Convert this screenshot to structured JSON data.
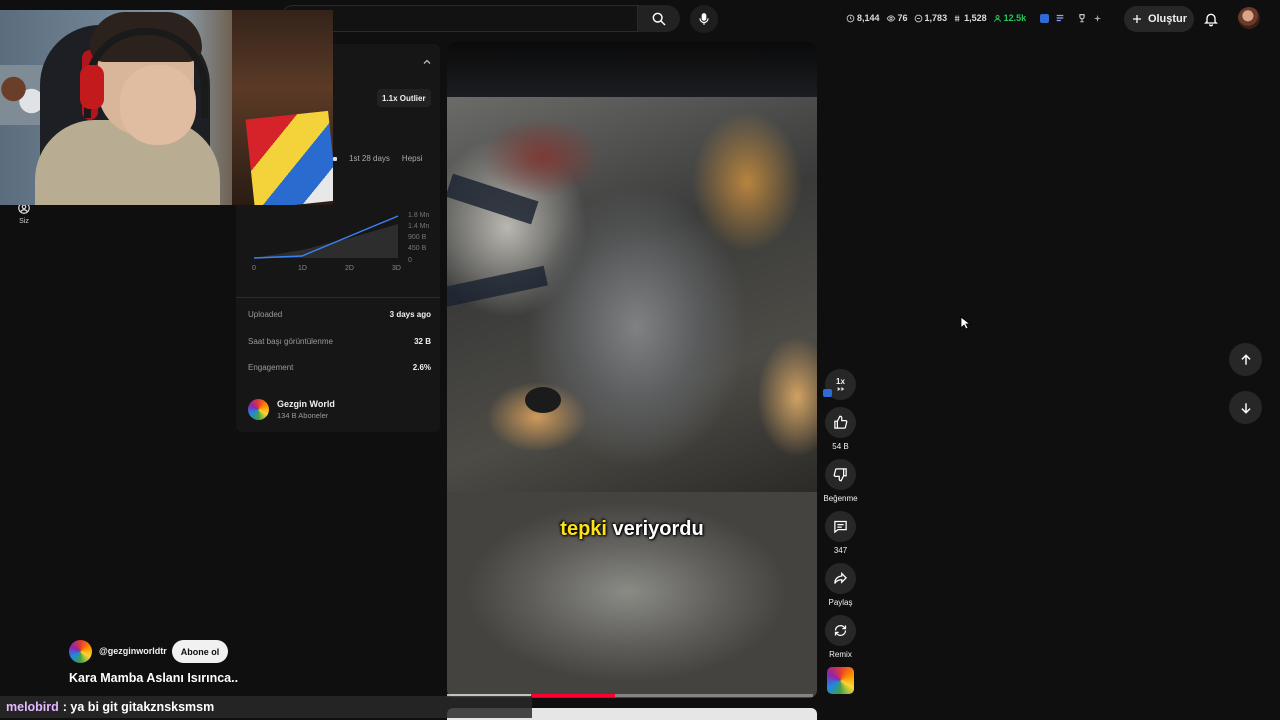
{
  "header": {
    "create_label": "Oluştur",
    "stats": [
      {
        "icon": "clock-icon",
        "value": "8,144"
      },
      {
        "icon": "eye-icon",
        "value": "76"
      },
      {
        "icon": "views-icon",
        "value": "1,783"
      },
      {
        "icon": "coin-icon",
        "value": "1,528"
      },
      {
        "icon": "user-icon",
        "value": "12.5k",
        "color": "#22c55e"
      }
    ]
  },
  "sidebar": {
    "you_label": "Siz"
  },
  "analytics": {
    "outlier_badge": "1.1x Outlier",
    "range_tabs": [
      "1st 28 days",
      "Hepsi"
    ],
    "chart": {
      "x_labels": [
        "0",
        "1D",
        "2D",
        "3D"
      ],
      "y_labels": [
        "1.8 Mn",
        "1.4 Mn",
        "900 B",
        "450 B",
        "0"
      ]
    },
    "metrics": [
      {
        "label": "Uploaded",
        "value": "3 days ago"
      },
      {
        "label": "Saat başı görüntülenme",
        "value": "32 B"
      },
      {
        "label": "Engagement",
        "value": "2.6%"
      }
    ],
    "channel": {
      "name": "Gezgin World",
      "subs": "134 B Aboneler"
    }
  },
  "video": {
    "caption_highlight": "tepki",
    "caption_rest": " veriyordu",
    "progress_played": 0.46,
    "progress_buffered": 0.23
  },
  "actions": {
    "speed": "1x",
    "like_count": "54 B",
    "dislike_label": "Beğenme",
    "comment_count": "347",
    "share_label": "Paylaş",
    "remix_label": "Remix"
  },
  "overlay": {
    "handle": "@gezginworldtr",
    "subscribe_label": "Abone ol",
    "title": "Kara Mamba Aslanı Isırınca.."
  },
  "chat": {
    "user": "melobird",
    "message": ": ya bi git gitakznsksmsm"
  },
  "colors": {
    "accent_red": "#ff0033",
    "caption_yellow": "#ffe21a",
    "chart_line": "#3b82f6",
    "chat_user": "#e4b7ff"
  }
}
